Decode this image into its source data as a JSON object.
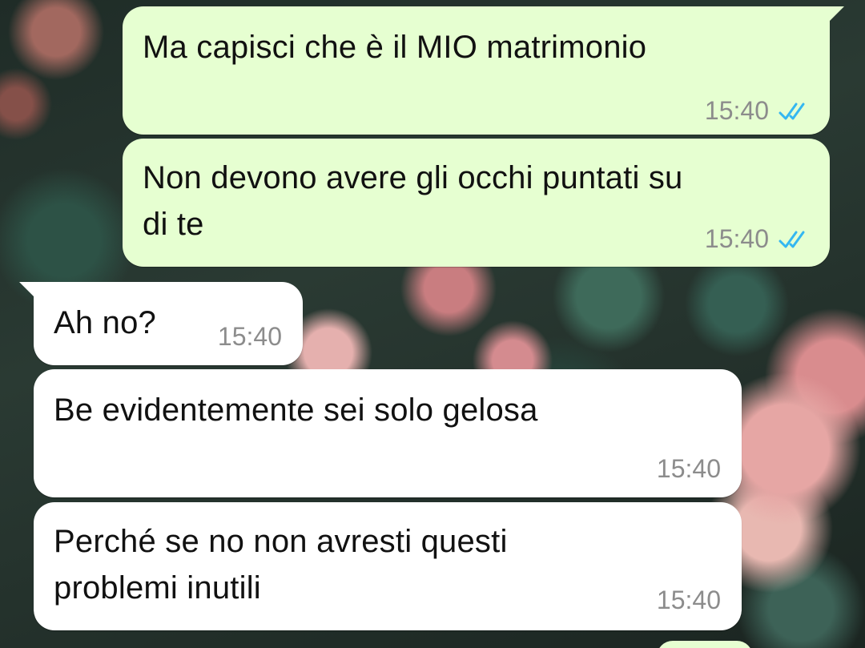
{
  "messages": [
    {
      "id": "m1",
      "direction": "outgoing",
      "text": "Ma capisci che è il MIO matrimonio",
      "time": "15:40",
      "status": "read"
    },
    {
      "id": "m2",
      "direction": "outgoing",
      "text": "Non devono avere gli occhi puntati su\ndi te",
      "time": "15:40",
      "status": "read"
    },
    {
      "id": "m3",
      "direction": "incoming",
      "text": "Ah no?",
      "time": "15:40"
    },
    {
      "id": "m4",
      "direction": "incoming",
      "text": "Be evidentemente sei solo gelosa",
      "time": "15:40"
    },
    {
      "id": "m5",
      "direction": "incoming",
      "text": "Perché se no non avresti questi\nproblemi inutili",
      "time": "15:40"
    }
  ],
  "colors": {
    "outgoing_bubble": "#e6ffd1",
    "incoming_bubble": "#ffffff",
    "read_ticks": "#34b7f1",
    "timestamp": "#8c8c8c"
  },
  "icons": {
    "read_receipt": "double-check-icon"
  }
}
